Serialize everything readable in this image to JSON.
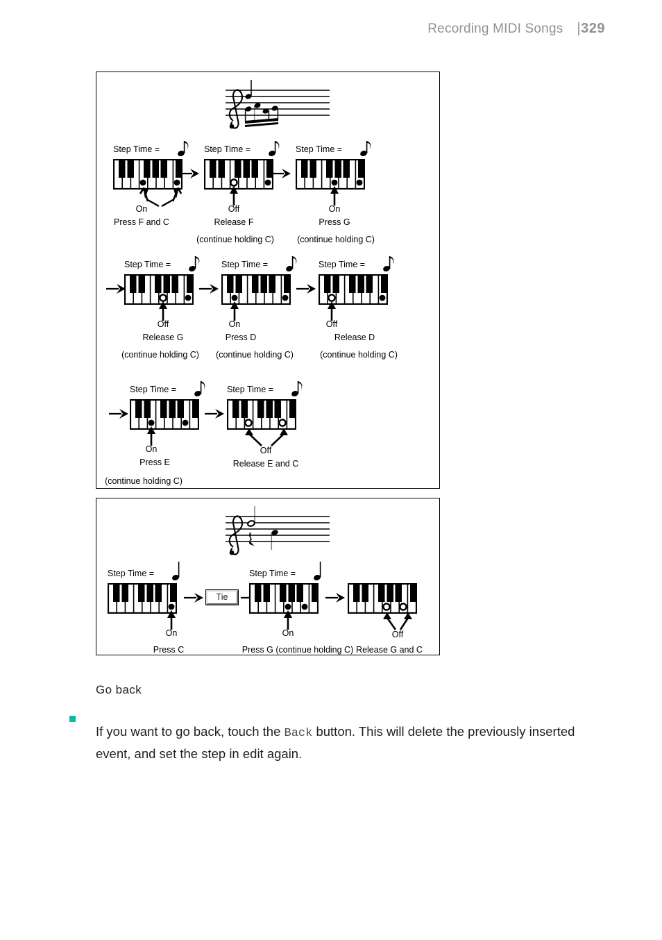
{
  "header": {
    "chapter": "Recording MIDI Songs",
    "bar": "|",
    "page_number": "329",
    "chapter_color": "#8e9293"
  },
  "figure_1": {
    "name": "step-recording-note-sequence",
    "staff": {
      "clef": "treble-clef",
      "notes": "C chord with beamed eighth notes F C G D E"
    },
    "rows": [
      {
        "steps": [
          {
            "step_time_label": "Step Time =",
            "note_icon": "eighth-note",
            "keyboard": {
              "keys": 8,
              "markers": [
                {
                  "key": 4,
                  "type": "on"
                },
                {
                  "key": 8,
                  "type": "on"
                }
              ]
            },
            "state": "On",
            "action": "Press F and C",
            "hold_note": ""
          },
          {
            "step_time_label": "Step Time =",
            "note_icon": "eighth-note",
            "keyboard": {
              "keys": 8,
              "markers": [
                {
                  "key": 4,
                  "type": "off"
                },
                {
                  "key": 8,
                  "type": "on"
                }
              ]
            },
            "state": "Off",
            "action": "Release F",
            "hold_note": "(continue holding C)"
          },
          {
            "step_time_label": "Step Time =",
            "note_icon": "eighth-note",
            "keyboard": {
              "keys": 8,
              "markers": [
                {
                  "key": 5,
                  "type": "on"
                },
                {
                  "key": 8,
                  "type": "on"
                }
              ]
            },
            "state": "On",
            "action": "Press G",
            "hold_note": "(continue holding C)"
          }
        ]
      },
      {
        "steps": [
          {
            "step_time_label": "Step Time =",
            "note_icon": "eighth-note",
            "keyboard": {
              "keys": 8,
              "markers": [
                {
                  "key": 5,
                  "type": "off"
                },
                {
                  "key": 8,
                  "type": "on"
                }
              ]
            },
            "state": "Off",
            "action": "Release G",
            "hold_note": "(continue holding C)"
          },
          {
            "step_time_label": "Step Time =",
            "note_icon": "eighth-note",
            "keyboard": {
              "keys": 8,
              "markers": [
                {
                  "key": 2,
                  "type": "on"
                },
                {
                  "key": 8,
                  "type": "on"
                }
              ]
            },
            "state": "On",
            "action": "Press D",
            "hold_note": "(continue holding C)"
          },
          {
            "step_time_label": "Step Time =",
            "note_icon": "eighth-note",
            "keyboard": {
              "keys": 8,
              "markers": [
                {
                  "key": 2,
                  "type": "off"
                },
                {
                  "key": 8,
                  "type": "on"
                }
              ]
            },
            "state": "Off",
            "action": "Release D",
            "hold_note": "(continue holding C)"
          }
        ]
      },
      {
        "steps": [
          {
            "step_time_label": "Step Time =",
            "note_icon": "eighth-note",
            "keyboard": {
              "keys": 8,
              "markers": [
                {
                  "key": 3,
                  "type": "on"
                },
                {
                  "key": 7,
                  "type": "on"
                }
              ]
            },
            "state": "On",
            "action": "Press E",
            "hold_note": "(continue holding C)"
          },
          {
            "step_time_label": "Step Time =",
            "note_icon": "eighth-note",
            "keyboard": {
              "keys": 8,
              "markers": [
                {
                  "key": 3,
                  "type": "off"
                },
                {
                  "key": 7,
                  "type": "off"
                }
              ]
            },
            "state": "Off",
            "action": "Release E and C",
            "hold_note": ""
          }
        ]
      }
    ]
  },
  "figure_2": {
    "name": "step-recording-tie-example",
    "staff": {
      "clef": "treble-clef",
      "notes": "half note, quarter rest, quarter note"
    },
    "steps": [
      {
        "step_time_label": "Step Time =",
        "note_icon": "quarter-note",
        "keyboard": {
          "keys": 8,
          "markers": [
            {
              "key": 8,
              "type": "on"
            }
          ]
        },
        "state": "On",
        "action": "Press C"
      },
      {
        "tie_label": "Tie"
      },
      {
        "step_time_label": "Step Time =",
        "note_icon": "quarter-note",
        "keyboard": {
          "keys": 8,
          "markers": [
            {
              "key": 5,
              "type": "on"
            },
            {
              "key": 8,
              "type": "on"
            }
          ]
        },
        "state": "On",
        "action": "Press G (continue holding C)"
      },
      {
        "keyboard": {
          "keys": 8,
          "markers": [
            {
              "key": 5,
              "type": "off"
            },
            {
              "key": 8,
              "type": "off"
            }
          ]
        },
        "state": "Off",
        "action": "Release G and C"
      }
    ]
  },
  "body": {
    "heading": "Go back",
    "bullet_color": "#00bfa5",
    "paragraph_part1": "If you want to go back, touch the ",
    "paragraph_code": "Back",
    "paragraph_part2": " button. This will delete the previously inserted event, and set the step in edit again."
  }
}
